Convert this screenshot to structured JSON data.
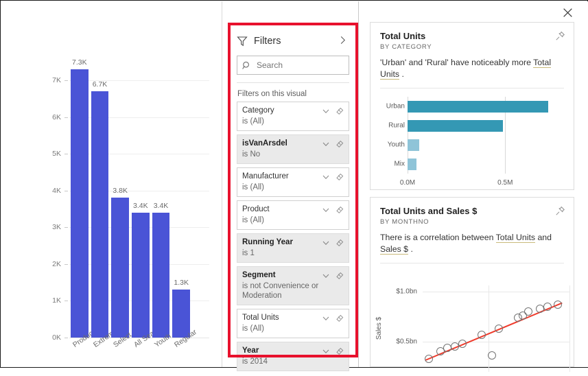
{
  "window": {
    "close_label": "✕"
  },
  "bar_report": {
    "y_ticks": [
      "0K",
      "1K",
      "2K",
      "3K",
      "4K",
      "5K",
      "6K",
      "7K"
    ]
  },
  "filters_pane": {
    "title": "Filters",
    "expand_icon": "chevron-right-icon",
    "funnel_icon": "funnel-icon",
    "search": {
      "placeholder": "Search",
      "value": "",
      "icon": "search-icon"
    },
    "section_label": "Filters on this visual",
    "cards": [
      {
        "field": "Category",
        "condition": "is (All)",
        "applied": false
      },
      {
        "field": "isVanArsdel",
        "condition": "is No",
        "applied": true
      },
      {
        "field": "Manufacturer",
        "condition": "is (All)",
        "applied": false
      },
      {
        "field": "Product",
        "condition": "is (All)",
        "applied": false
      },
      {
        "field": "Running Year",
        "condition": "is 1",
        "applied": true
      },
      {
        "field": "Segment",
        "condition": "is not Convenience or Moderation",
        "applied": true
      },
      {
        "field": "Total Units",
        "condition": "is (All)",
        "applied": false
      },
      {
        "field": "Year",
        "condition": "is 2014",
        "applied": true
      }
    ]
  },
  "insights": {
    "card1": {
      "title": "Total Units",
      "subtitle": "BY CATEGORY",
      "desc_pre": "'Urban' and 'Rural' have noticeably more ",
      "desc_link": "Total Units",
      "desc_post": " .",
      "pin_icon": "pin-icon"
    },
    "card2": {
      "title": "Total Units and Sales $",
      "subtitle": "BY MONTHNO",
      "desc_pre": "There is a correlation between ",
      "desc_link1": "Total Units",
      "desc_mid": " and ",
      "desc_link2": "Sales $",
      "desc_post": " .",
      "pin_icon": "pin-icon"
    }
  },
  "colors": {
    "bar_blue": "#4a54d6",
    "teal_dark": "#3498b4",
    "teal_light": "#8fc4d8",
    "highlight_red": "#e8112d",
    "trend_red": "#ef3b2c"
  },
  "chart_data": [
    {
      "type": "bar",
      "title": "",
      "xlabel": "",
      "ylabel": "",
      "categories": [
        "Productivity",
        "Extreme",
        "Select",
        "All Season",
        "Youth",
        "Regular"
      ],
      "values": [
        7300,
        6700,
        3800,
        3400,
        3400,
        1300
      ],
      "data_labels": [
        "7.3K",
        "6.7K",
        "3.8K",
        "3.4K",
        "3.4K",
        "1.3K"
      ],
      "ytick_labels": [
        "0K",
        "1K",
        "2K",
        "3K",
        "4K",
        "5K",
        "6K",
        "7K"
      ],
      "ytick_values": [
        0,
        1000,
        2000,
        3000,
        4000,
        5000,
        6000,
        7000
      ],
      "ylim": [
        0,
        7500
      ],
      "grid": true,
      "legend": "none",
      "series_color": "#4a54d6"
    },
    {
      "type": "bar",
      "orientation": "horizontal",
      "title": "Total Units",
      "subtitle": "BY CATEGORY",
      "xlabel": "",
      "ylabel": "",
      "categories": [
        "Urban",
        "Rural",
        "Youth",
        "Mix"
      ],
      "values": [
        0.72,
        0.49,
        0.06,
        0.045
      ],
      "xtick_labels": [
        "0.0M",
        "0.5M"
      ],
      "xtick_values": [
        0,
        0.5
      ],
      "xlim": [
        0,
        0.78
      ],
      "grid": true,
      "legend": "none",
      "bar_colors": [
        "#3498b4",
        "#3498b4",
        "#8fc4d8",
        "#8fc4d8"
      ]
    },
    {
      "type": "scatter",
      "title": "Total Units and Sales $",
      "subtitle": "BY MONTHNO",
      "xlabel": "",
      "ylabel": "Sales $",
      "ytick_labels": [
        "$0.5bn",
        "$1.0bn"
      ],
      "ytick_values": [
        0.5,
        1.0
      ],
      "ylim": [
        0.28,
        1.06
      ],
      "grid": true,
      "legend": "none",
      "trendline": true,
      "trendline_color": "#ef3b2c",
      "points": [
        {
          "x": 0.04,
          "y": 0.33
        },
        {
          "x": 0.12,
          "y": 0.4
        },
        {
          "x": 0.17,
          "y": 0.44
        },
        {
          "x": 0.22,
          "y": 0.45
        },
        {
          "x": 0.27,
          "y": 0.48
        },
        {
          "x": 0.4,
          "y": 0.57
        },
        {
          "x": 0.52,
          "y": 0.63
        },
        {
          "x": 0.47,
          "y": 0.36
        },
        {
          "x": 0.65,
          "y": 0.74
        },
        {
          "x": 0.68,
          "y": 0.76
        },
        {
          "x": 0.72,
          "y": 0.8
        },
        {
          "x": 0.8,
          "y": 0.83
        },
        {
          "x": 0.85,
          "y": 0.85
        },
        {
          "x": 0.92,
          "y": 0.87
        }
      ]
    }
  ]
}
